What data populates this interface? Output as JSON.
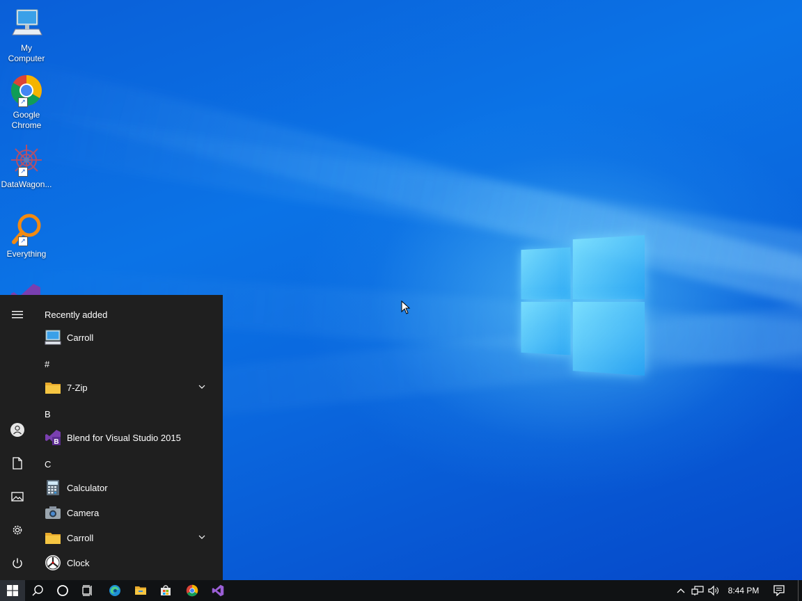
{
  "desktop": {
    "icons": [
      {
        "label": "My\nComputer",
        "label_line1": "My",
        "label_line2": "Computer",
        "icon": "monitor-icon"
      },
      {
        "label_line1": "Google",
        "label_line2": "Chrome",
        "icon": "chrome-icon"
      },
      {
        "label_line1": "DataWagon...",
        "label_line2": "",
        "icon": "datawagon-icon"
      },
      {
        "label_line1": "Everything",
        "label_line2": "",
        "icon": "magnifier-icon"
      }
    ]
  },
  "start_menu": {
    "recently_added": "Recently added",
    "sections": {
      "hash": "#",
      "b": "B",
      "c": "C"
    },
    "apps": {
      "recent_carroll": "Carroll",
      "seven_zip": "7-Zip",
      "blend": "Blend for Visual Studio 2015",
      "calculator": "Calculator",
      "camera": "Camera",
      "carroll_folder": "Carroll",
      "clock": "Clock"
    }
  },
  "taskbar": {
    "clock": "8:44 PM"
  },
  "colors": {
    "accent": "#0a6fe0",
    "menu_bg": "#1f1f1f",
    "taskbar_bg": "#101214",
    "folder": "#f5c542"
  }
}
